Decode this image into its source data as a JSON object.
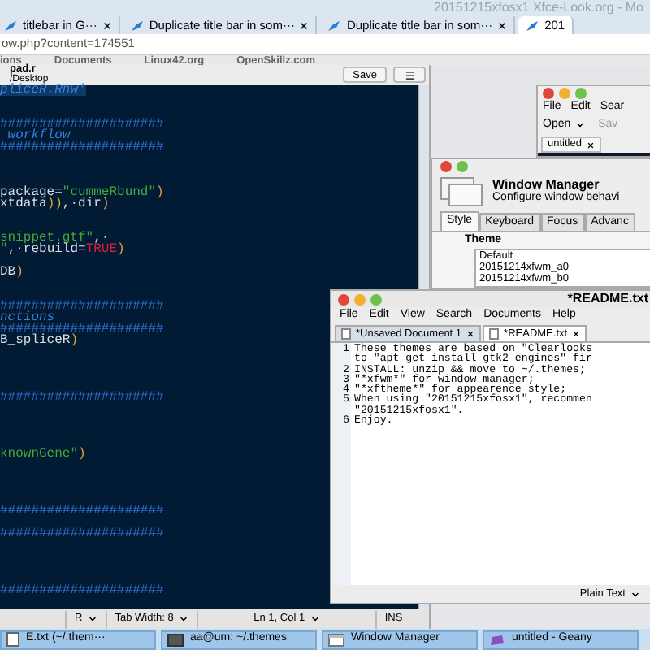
{
  "browser": {
    "title": "20151215xfosx1 Xfce-Look.org - Mo",
    "tabs": [
      {
        "label": "titlebar in G···",
        "selected": false
      },
      {
        "label": "Duplicate title bar in som···",
        "selected": false
      },
      {
        "label": "Duplicate title bar in som···",
        "selected": false
      },
      {
        "label": "201",
        "selected": true
      }
    ],
    "url": "ow.php?content=174551",
    "bookmarks": [
      "ions",
      "Documents",
      "Linux42.org",
      "OpenSkillz.com"
    ]
  },
  "editor": {
    "title": "pad.r",
    "subtitle": "/Desktop",
    "save": "Save",
    "lines": [
      {
        "kind": "code",
        "highlighted": true,
        "segments": [
          {
            "text": "pliceR.Rnw'",
            "kind": "comment"
          }
        ]
      },
      {
        "kind": "blank"
      },
      {
        "kind": "blank"
      },
      {
        "kind": "code",
        "highlighted": false,
        "segments": [
          {
            "text": "#####################",
            "kind": "rule"
          }
        ]
      },
      {
        "kind": "code",
        "highlighted": false,
        "segments": [
          {
            "text": " workflow",
            "kind": "comment"
          }
        ]
      },
      {
        "kind": "code",
        "highlighted": false,
        "segments": [
          {
            "text": "#####################",
            "kind": "rule"
          }
        ]
      },
      {
        "kind": "blank"
      },
      {
        "kind": "blank"
      },
      {
        "kind": "blank"
      },
      {
        "kind": "code",
        "highlighted": false,
        "segments": [
          {
            "text": "package=",
            "kind": "text"
          },
          {
            "text": "\"cummeRbund\"",
            "kind": "string"
          },
          {
            "text": ")",
            "kind": "punct"
          }
        ]
      },
      {
        "kind": "code",
        "highlighted": false,
        "segments": [
          {
            "text": "xtdata",
            "kind": "text"
          },
          {
            "text": "))",
            "kind": "punct"
          },
          {
            "text": ",·dir",
            "kind": "text"
          },
          {
            "text": ")",
            "kind": "punct"
          }
        ]
      },
      {
        "kind": "blank"
      },
      {
        "kind": "blank"
      },
      {
        "kind": "code",
        "highlighted": false,
        "segments": [
          {
            "text": "snippet.gtf\"",
            "kind": "string"
          },
          {
            "text": ",·",
            "kind": "text"
          }
        ]
      },
      {
        "kind": "code",
        "highlighted": false,
        "segments": [
          {
            "text": "\"",
            "kind": "string"
          },
          {
            "text": ",·rebuild=",
            "kind": "text"
          },
          {
            "text": "TRUE",
            "kind": "constant"
          },
          {
            "text": ")",
            "kind": "punct"
          }
        ]
      },
      {
        "kind": "blank"
      },
      {
        "kind": "code",
        "highlighted": false,
        "segments": [
          {
            "text": "DB",
            "kind": "text"
          },
          {
            "text": ")",
            "kind": "punct"
          }
        ]
      },
      {
        "kind": "blank"
      },
      {
        "kind": "blank"
      },
      {
        "kind": "code",
        "highlighted": false,
        "segments": [
          {
            "text": "#####################",
            "kind": "rule"
          }
        ]
      },
      {
        "kind": "code",
        "highlighted": false,
        "segments": [
          {
            "text": "nctions",
            "kind": "comment"
          }
        ]
      },
      {
        "kind": "code",
        "highlighted": false,
        "segments": [
          {
            "text": "#####################",
            "kind": "rule"
          }
        ]
      },
      {
        "kind": "code",
        "highlighted": false,
        "segments": [
          {
            "text": "B_spliceR",
            "kind": "text"
          },
          {
            "text": ")",
            "kind": "punct"
          }
        ]
      },
      {
        "kind": "blank"
      },
      {
        "kind": "blank"
      },
      {
        "kind": "blank"
      },
      {
        "kind": "blank"
      },
      {
        "kind": "code",
        "highlighted": false,
        "segments": [
          {
            "text": "#####################",
            "kind": "rule"
          }
        ]
      },
      {
        "kind": "blank"
      },
      {
        "kind": "blank"
      },
      {
        "kind": "blank"
      },
      {
        "kind": "blank"
      },
      {
        "kind": "code",
        "highlighted": false,
        "segments": [
          {
            "text": "knownGene\"",
            "kind": "string"
          },
          {
            "text": ")",
            "kind": "punct"
          }
        ]
      },
      {
        "kind": "blank"
      },
      {
        "kind": "blank"
      },
      {
        "kind": "blank"
      },
      {
        "kind": "blank"
      },
      {
        "kind": "code",
        "highlighted": false,
        "segments": [
          {
            "text": "#####################",
            "kind": "rule"
          }
        ]
      },
      {
        "kind": "blank"
      },
      {
        "kind": "code",
        "highlighted": false,
        "segments": [
          {
            "text": "#####################",
            "kind": "rule"
          }
        ]
      },
      {
        "kind": "blank"
      },
      {
        "kind": "blank"
      },
      {
        "kind": "blank"
      },
      {
        "kind": "blank"
      },
      {
        "kind": "code",
        "highlighted": false,
        "segments": [
          {
            "text": "#####################",
            "kind": "rule"
          }
        ]
      }
    ],
    "status": [
      {
        "label": "R",
        "kind": "dropdown"
      },
      {
        "label": "Tab Width: 8",
        "kind": "dropdown"
      },
      {
        "label": "Ln 1, Col 1",
        "kind": "dropdown"
      },
      {
        "label": "INS",
        "kind": "indicator"
      }
    ]
  },
  "geany": {
    "window_buttons": [
      {
        "kind": "close"
      },
      {
        "kind": "minimize"
      },
      {
        "kind": "maximize"
      }
    ],
    "menu": [
      "File",
      "Edit",
      "Sear"
    ],
    "open": "Open",
    "save": "Sav",
    "tab": "untitled"
  },
  "window_manager": {
    "window_buttons": [
      {
        "kind": "close"
      },
      {
        "kind": "maximize"
      }
    ],
    "title": "Window Manager",
    "subtitle": "Configure window behavi",
    "tabs": [
      {
        "label": "Style",
        "selected": true
      },
      {
        "label": "Keyboard",
        "selected": false
      },
      {
        "label": "Focus",
        "selected": false
      },
      {
        "label": "Advanc",
        "selected": false
      }
    ],
    "theme_label": "Theme",
    "themes": [
      "Default",
      "20151214xfwm_a0",
      "20151214xfwm_b0"
    ]
  },
  "readme": {
    "window_buttons": [
      {
        "kind": "close"
      },
      {
        "kind": "minimize"
      },
      {
        "kind": "maximize"
      }
    ],
    "title": "*README.txt",
    "menu": [
      "File",
      "Edit",
      "View",
      "Search",
      "Documents",
      "Help"
    ],
    "tabs": [
      {
        "label": "*Unsaved Document 1",
        "selected": false
      },
      {
        "label": "*README.txt",
        "selected": true
      }
    ],
    "lines": [
      {
        "number": "1",
        "text": "These themes are based on \"Clearlooks"
      },
      {
        "text": "to \"apt-get install gtk2-engines\" fir"
      },
      {
        "number": "2",
        "text": "INSTALL: unzip && move to ~/.themes;"
      },
      {
        "number": "3",
        "text": "\"*xfwm*\" for window manager;"
      },
      {
        "number": "4",
        "text": "\"*xftheme*\" for appearence style;"
      },
      {
        "number": "5",
        "text": "When using \"20151215xfosx1\", recommen"
      },
      {
        "text": "\"20151215xfosx1\"."
      },
      {
        "number": "6",
        "text": "Enjoy."
      }
    ],
    "status": "Plain Text"
  },
  "taskbar": [
    {
      "label": "E.txt (~/.them···"
    },
    {
      "label": "aa@um: ~/.themes"
    },
    {
      "label": "Window Manager"
    },
    {
      "label": "untitled - Geany"
    }
  ]
}
